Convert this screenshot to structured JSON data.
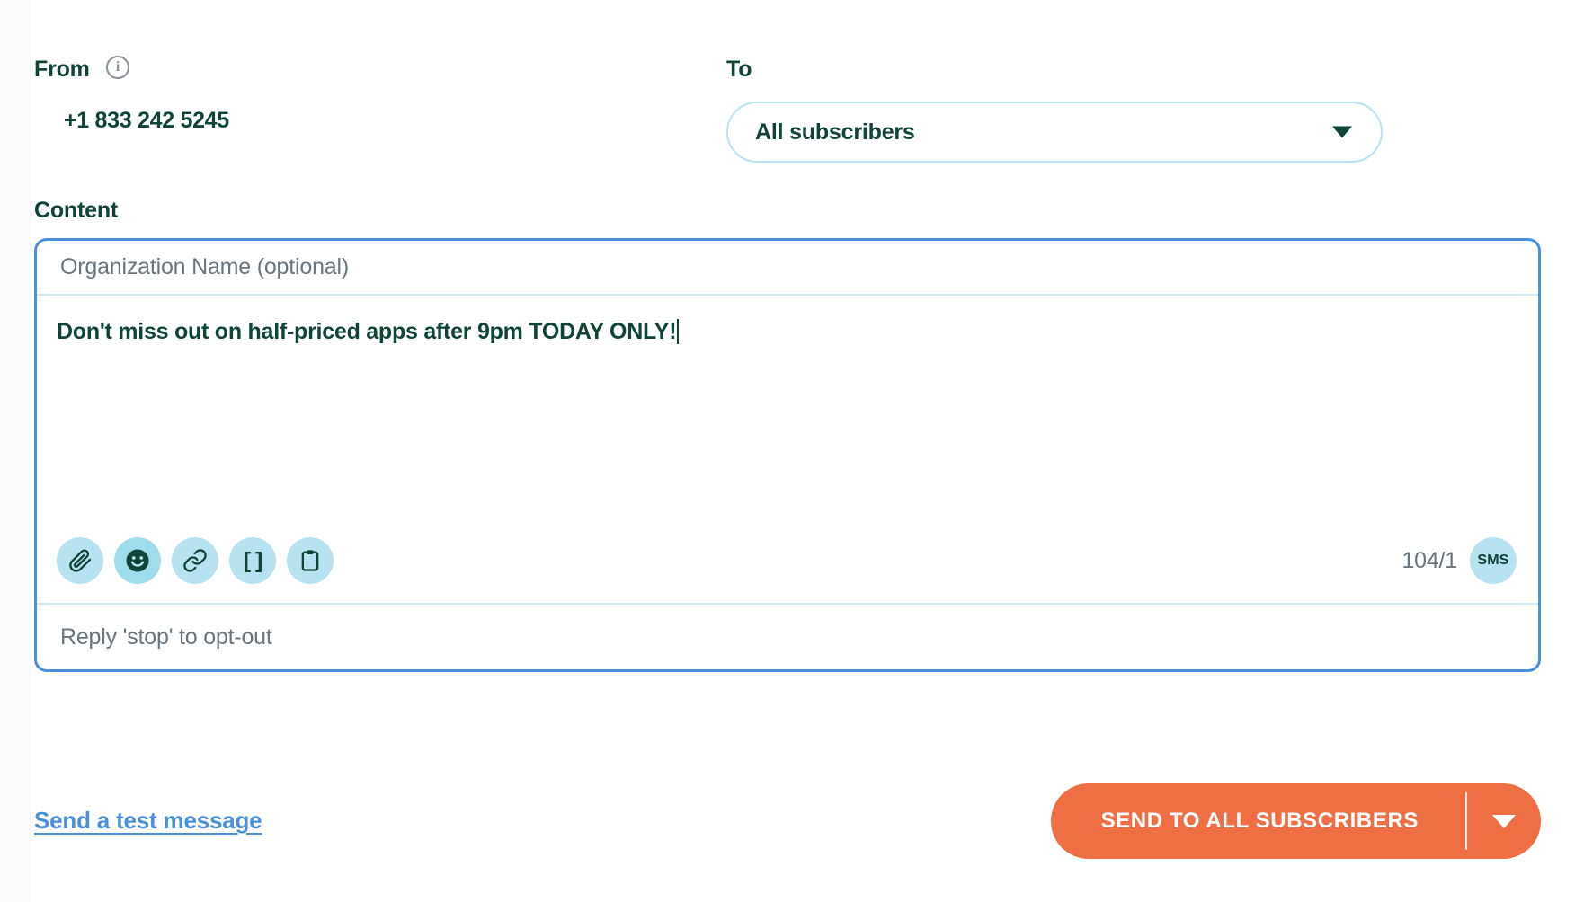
{
  "colors": {
    "brand_green": "#0f4536",
    "accent_blue": "#4a90d9",
    "icon_bg": "#b6e3ef",
    "send_orange": "#ef6f45",
    "muted_text": "#68757f",
    "divider": "#cfeaf3"
  },
  "from": {
    "label": "From",
    "info_icon": "info-icon",
    "info_glyph": "i",
    "value": "+1 833 242 5245"
  },
  "to": {
    "label": "To",
    "selected_value": "All subscribers",
    "caret_icon": "chevron-down-icon"
  },
  "content": {
    "label": "Content",
    "organization_placeholder": "Organization Name (optional)",
    "organization_value": "",
    "message_text": "Don't miss out on half-priced apps after 9pm TODAY ONLY!",
    "optout_text": "Reply 'stop' to opt-out",
    "char_counter": "104/1",
    "message_type_badge": "SMS",
    "toolbar": [
      {
        "name": "attach-file-button",
        "icon": "paperclip-icon",
        "active": false
      },
      {
        "name": "emoji-button",
        "icon": "smiley-face-icon",
        "active": true
      },
      {
        "name": "insert-link-button",
        "icon": "link-icon",
        "active": false
      },
      {
        "name": "merge-tag-button",
        "icon": "brackets-icon",
        "glyph": "[ ]",
        "active": false
      },
      {
        "name": "paste-template-button",
        "icon": "clipboard-icon",
        "active": false
      }
    ]
  },
  "footer": {
    "test_link": "Send a test message",
    "send_button": "SEND TO ALL SUBSCRIBERS",
    "send_caret_icon": "chevron-down-icon"
  }
}
